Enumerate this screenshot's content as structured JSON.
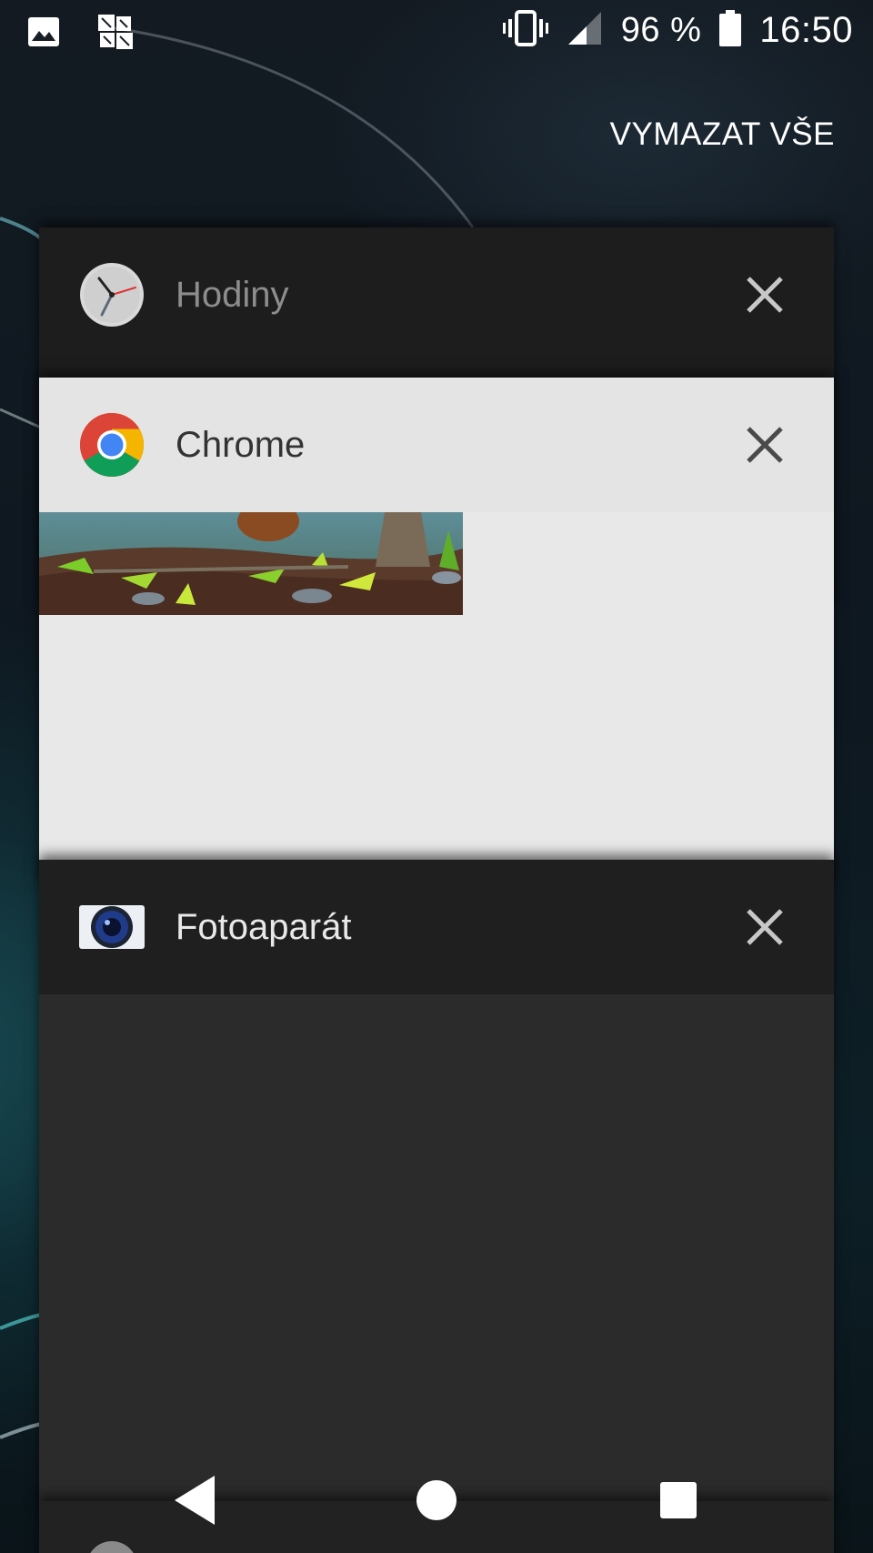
{
  "status_bar": {
    "notification_icons": [
      "image-icon",
      "app-notification-icon"
    ],
    "system_icons": [
      "vibrate-icon",
      "signal-icon",
      "battery-icon"
    ],
    "battery": "96 %",
    "time": "16:50"
  },
  "clear_all_label": "VYMAZAT VŠE",
  "recent_apps": [
    {
      "title": "Hodiny",
      "icon": "clock-icon"
    },
    {
      "title": "Chrome",
      "icon": "chrome-icon"
    },
    {
      "title": "Fotoaparát",
      "icon": "camera-icon"
    }
  ],
  "navigation": {
    "buttons": [
      "back-icon",
      "home-icon",
      "recents-icon"
    ]
  },
  "colors": {
    "card_dark": "#1d1d1d",
    "card_light": "#e8e8e8",
    "text_white": "#ffffff"
  }
}
